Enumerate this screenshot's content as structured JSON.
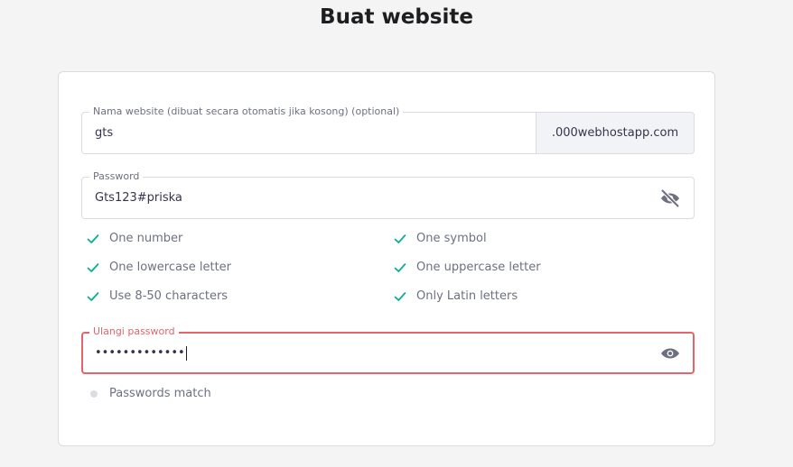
{
  "page": {
    "title": "Buat website"
  },
  "website_field": {
    "label": "Nama website (dibuat secara otomatis jika kosong) (optional)",
    "value": "gts",
    "suffix": ".000webhostapp.com"
  },
  "password_field": {
    "label": "Password",
    "value": "Gts123#priska",
    "toggle_icon": "eye-off-icon"
  },
  "requirements": [
    {
      "label": "One number",
      "met": true
    },
    {
      "label": "One symbol",
      "met": true
    },
    {
      "label": "One lowercase letter",
      "met": true
    },
    {
      "label": "One uppercase letter",
      "met": true
    },
    {
      "label": "Use 8-50 characters",
      "met": true
    },
    {
      "label": "Only Latin letters",
      "met": true
    }
  ],
  "repeat_field": {
    "label": "Ulangi password",
    "value": "•••••••••••••",
    "toggle_icon": "eye-icon"
  },
  "match_status": {
    "label": "Passwords match",
    "met": false
  },
  "colors": {
    "check": "#00b090",
    "error": "#e5636a",
    "pending_dot": "#dadce0"
  }
}
